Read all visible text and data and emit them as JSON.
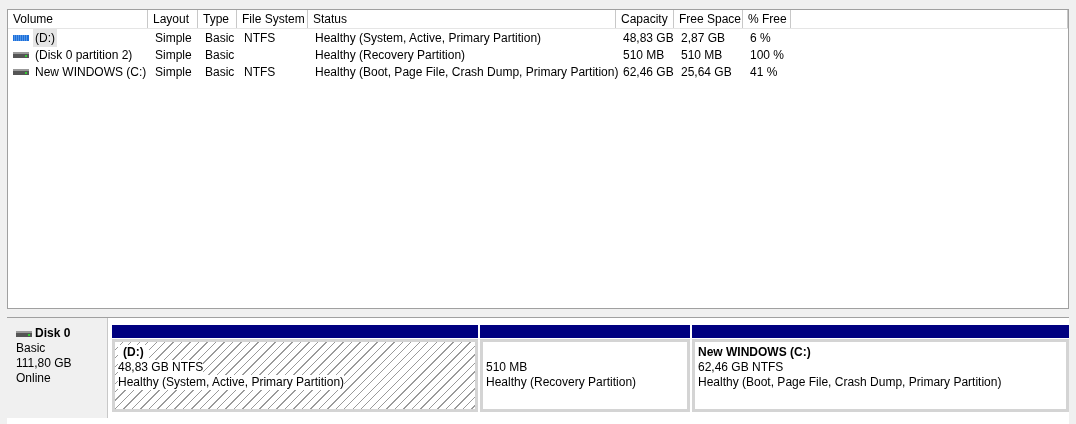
{
  "volume_table": {
    "columns": [
      "Volume",
      "Layout",
      "Type",
      "File System",
      "Status",
      "Capacity",
      "Free Space",
      "% Free"
    ],
    "rows": [
      {
        "kind": "system",
        "selected": true,
        "cells": [
          "(D:)",
          "Simple",
          "Basic",
          "NTFS",
          "Healthy (System, Active, Primary Partition)",
          "48,83 GB",
          "2,87 GB",
          "6 %"
        ]
      },
      {
        "kind": "basic",
        "selected": false,
        "cells": [
          "(Disk 0 partition 2)",
          "Simple",
          "Basic",
          "",
          "Healthy (Recovery Partition)",
          "510 MB",
          "510 MB",
          "100 %"
        ]
      },
      {
        "kind": "basic",
        "selected": false,
        "cells": [
          "New WINDOWS (C:)",
          "Simple",
          "Basic",
          "NTFS",
          "Healthy (Boot, Page File, Crash Dump, Primary Partition)",
          "62,46 GB",
          "25,64 GB",
          "41 %"
        ]
      }
    ]
  },
  "disk": {
    "name": "Disk 0",
    "type": "Basic",
    "size": "111,80 GB",
    "state": "Online",
    "partitions": [
      {
        "name": "(D:)",
        "size": "48,83 GB NTFS",
        "status": "Healthy (System, Active, Primary Partition)",
        "selected": true
      },
      {
        "size": "510 MB",
        "status": "Healthy (Recovery Partition)",
        "selected": false
      },
      {
        "name": "New WINDOWS  (C:)",
        "size": "62,46 GB NTFS",
        "status": "Healthy (Boot, Page File, Crash Dump, Primary Partition)",
        "selected": false
      }
    ]
  }
}
